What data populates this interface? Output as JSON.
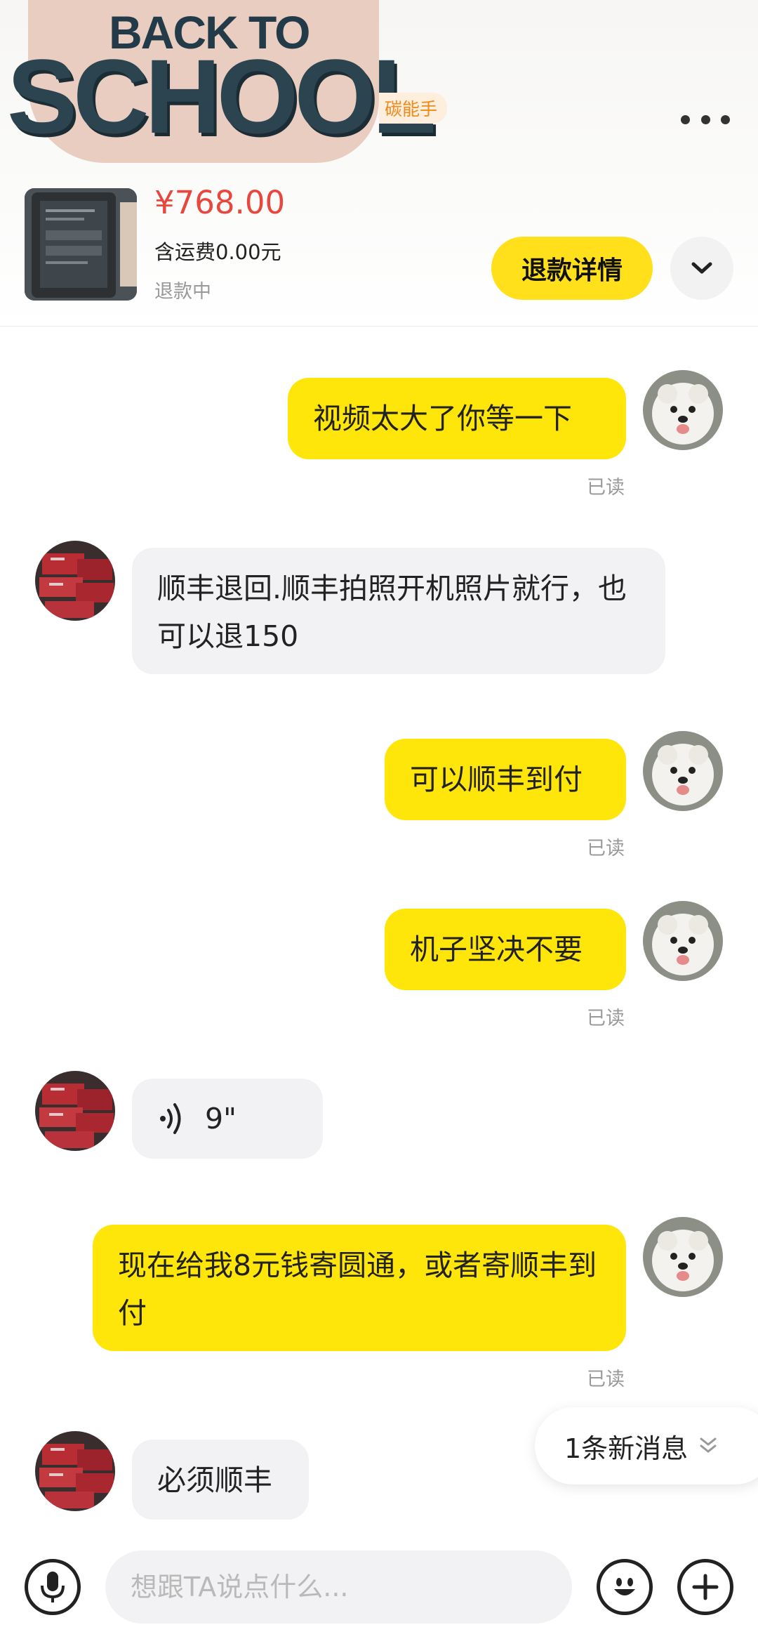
{
  "header": {
    "logo_line1": "BACK TO",
    "logo_line2": "SCHOOL",
    "badge": "碳能手"
  },
  "order": {
    "price": "¥768.00",
    "shipping": "含运费0.00元",
    "status": "退款中",
    "refund_button": "退款详情"
  },
  "messages": [
    {
      "side": "me",
      "text": "视频太大了你等一下",
      "read": "已读"
    },
    {
      "side": "them",
      "text": "顺丰退回.顺丰拍照开机照片就行，也可以退150"
    },
    {
      "side": "me",
      "text": "可以顺丰到付",
      "read": "已读"
    },
    {
      "side": "me",
      "text": "机子坚决不要",
      "read": "已读"
    },
    {
      "side": "them",
      "type": "voice",
      "duration": "9\""
    },
    {
      "side": "me",
      "text": "现在给我8元钱寄圆通，或者寄顺丰到付",
      "read": "已读"
    },
    {
      "side": "them",
      "text": "必须顺丰"
    }
  ],
  "new_messages": "1条新消息",
  "input": {
    "placeholder": "想跟TA说点什么..."
  },
  "colors": {
    "accent_yellow": "#ffe01b",
    "price_red": "#e8473d"
  },
  "icons": {
    "more": "more-dots-icon",
    "expand": "chevron-down-icon",
    "voice_input": "microphone-icon",
    "emoji": "emoji-icon",
    "add": "plus-icon",
    "voice_message": "sound-wave-icon",
    "new_message": "double-chevron-down-icon"
  }
}
